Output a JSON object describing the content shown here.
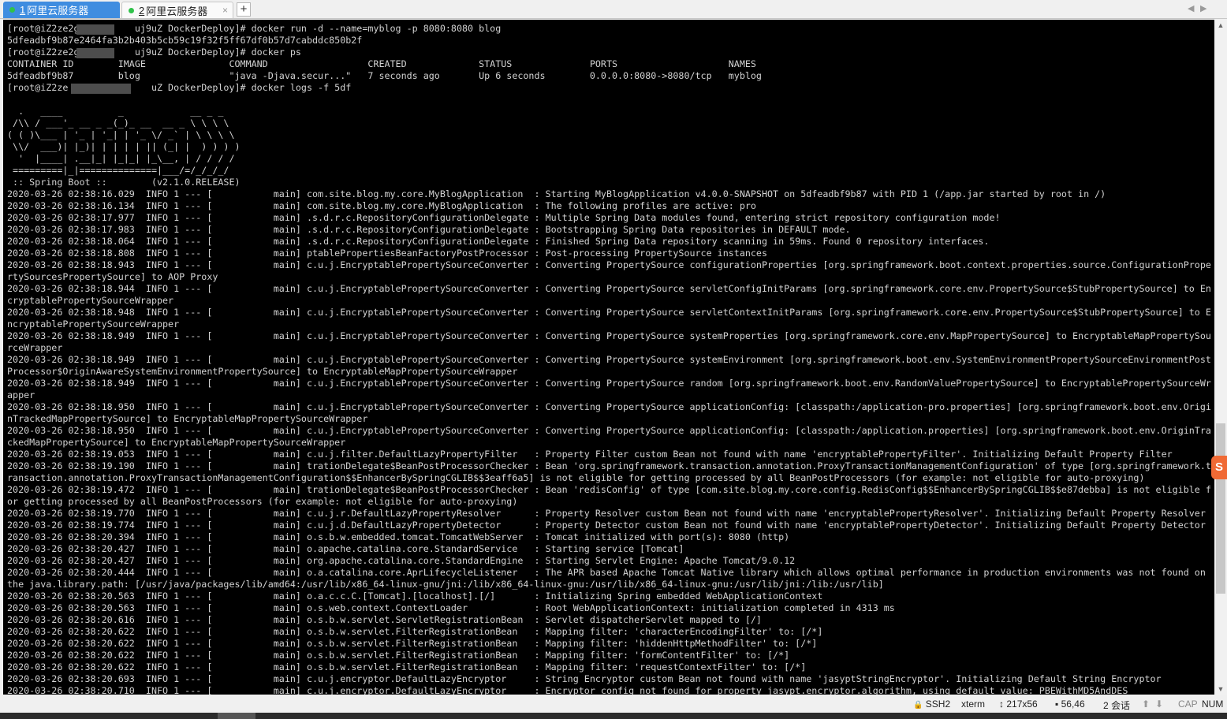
{
  "tabs": [
    {
      "num": "1",
      "label": "阿里云服务器",
      "active": true
    },
    {
      "num": "2",
      "label": "阿里云服务器",
      "active": false
    }
  ],
  "tab_controls": {
    "close": "×",
    "add": "+",
    "prev": "◀",
    "next": "▶"
  },
  "terminal": {
    "lines": [
      "[root@iZ2ze2g          uj9uZ DockerDeploy]# docker run -d --name=myblog -p 8080:8080 blog",
      "5dfeadbf9b87e2464fa3b2b403b5cb59c19f32f5ff67df0b57d7cabddc850b2f",
      "[root@iZ2ze2g          uj9uZ DockerDeploy]# docker ps",
      "CONTAINER ID        IMAGE               COMMAND                  CREATED             STATUS              PORTS                    NAMES",
      "5dfeadbf9b87        blog                \"java -Djava.secur...\"   7 seconds ago       Up 6 seconds        0.0.0.0:8080->8080/tcp   myblog",
      "[root@iZ2ze               uZ DockerDeploy]# docker logs -f 5df",
      "",
      "  .   ____          _            __ _ _",
      " /\\\\ / ___'_ __ _ _(_)_ __  __ _ \\ \\ \\ \\",
      "( ( )\\___ | '_ | '_| | '_ \\/ _` | \\ \\ \\ \\",
      " \\\\/  ___)| |_)| | | | | || (_| |  ) ) ) )",
      "  '  |____| .__|_| |_|_| |_\\__, | / / / /",
      " =========|_|==============|___/=/_/_/_/",
      " :: Spring Boot ::        (v2.1.0.RELEASE)",
      "2020-03-26 02:38:16.029  INFO 1 --- [           main] com.site.blog.my.core.MyBlogApplication  : Starting MyBlogApplication v4.0.0-SNAPSHOT on 5dfeadbf9b87 with PID 1 (/app.jar started by root in /)",
      "2020-03-26 02:38:16.134  INFO 1 --- [           main] com.site.blog.my.core.MyBlogApplication  : The following profiles are active: pro",
      "2020-03-26 02:38:17.977  INFO 1 --- [           main] .s.d.r.c.RepositoryConfigurationDelegate : Multiple Spring Data modules found, entering strict repository configuration mode!",
      "2020-03-26 02:38:17.983  INFO 1 --- [           main] .s.d.r.c.RepositoryConfigurationDelegate : Bootstrapping Spring Data repositories in DEFAULT mode.",
      "2020-03-26 02:38:18.064  INFO 1 --- [           main] .s.d.r.c.RepositoryConfigurationDelegate : Finished Spring Data repository scanning in 59ms. Found 0 repository interfaces.",
      "2020-03-26 02:38:18.808  INFO 1 --- [           main] ptablePropertiesBeanFactoryPostProcessor : Post-processing PropertySource instances",
      "2020-03-26 02:38:18.943  INFO 1 --- [           main] c.u.j.EncryptablePropertySourceConverter : Converting PropertySource configurationProperties [org.springframework.boot.context.properties.source.ConfigurationPrope",
      "rtySourcesPropertySource] to AOP Proxy",
      "2020-03-26 02:38:18.944  INFO 1 --- [           main] c.u.j.EncryptablePropertySourceConverter : Converting PropertySource servletConfigInitParams [org.springframework.core.env.PropertySource$StubPropertySource] to En",
      "cryptablePropertySourceWrapper",
      "2020-03-26 02:38:18.948  INFO 1 --- [           main] c.u.j.EncryptablePropertySourceConverter : Converting PropertySource servletContextInitParams [org.springframework.core.env.PropertySource$StubPropertySource] to E",
      "ncryptablePropertySourceWrapper",
      "2020-03-26 02:38:18.949  INFO 1 --- [           main] c.u.j.EncryptablePropertySourceConverter : Converting PropertySource systemProperties [org.springframework.core.env.MapPropertySource] to EncryptableMapPropertySou",
      "rceWrapper",
      "2020-03-26 02:38:18.949  INFO 1 --- [           main] c.u.j.EncryptablePropertySourceConverter : Converting PropertySource systemEnvironment [org.springframework.boot.env.SystemEnvironmentPropertySourceEnvironmentPost",
      "Processor$OriginAwareSystemEnvironmentPropertySource] to EncryptableMapPropertySourceWrapper",
      "2020-03-26 02:38:18.949  INFO 1 --- [           main] c.u.j.EncryptablePropertySourceConverter : Converting PropertySource random [org.springframework.boot.env.RandomValuePropertySource] to EncryptablePropertySourceWr",
      "apper",
      "2020-03-26 02:38:18.950  INFO 1 --- [           main] c.u.j.EncryptablePropertySourceConverter : Converting PropertySource applicationConfig: [classpath:/application-pro.properties] [org.springframework.boot.env.Origi",
      "nTrackedMapPropertySource] to EncryptableMapPropertySourceWrapper",
      "2020-03-26 02:38:18.950  INFO 1 --- [           main] c.u.j.EncryptablePropertySourceConverter : Converting PropertySource applicationConfig: [classpath:/application.properties] [org.springframework.boot.env.OriginTra",
      "ckedMapPropertySource] to EncryptableMapPropertySourceWrapper",
      "2020-03-26 02:38:19.053  INFO 1 --- [           main] c.u.j.filter.DefaultLazyPropertyFilter   : Property Filter custom Bean not found with name 'encryptablePropertyFilter'. Initializing Default Property Filter",
      "2020-03-26 02:38:19.190  INFO 1 --- [           main] trationDelegate$BeanPostProcessorChecker : Bean 'org.springframework.transaction.annotation.ProxyTransactionManagementConfiguration' of type [org.springframework.t",
      "ransaction.annotation.ProxyTransactionManagementConfiguration$$EnhancerBySpringCGLIB$$3eaff6a5] is not eligible for getting processed by all BeanPostProcessors (for example: not eligible for auto-proxying)",
      "2020-03-26 02:38:19.472  INFO 1 --- [           main] trationDelegate$BeanPostProcessorChecker : Bean 'redisConfig' of type [com.site.blog.my.core.config.RedisConfig$$EnhancerBySpringCGLIB$$e87debba] is not eligible f",
      "or getting processed by all BeanPostProcessors (for example: not eligible for auto-proxying)",
      "2020-03-26 02:38:19.770  INFO 1 --- [           main] c.u.j.r.DefaultLazyPropertyResolver      : Property Resolver custom Bean not found with name 'encryptablePropertyResolver'. Initializing Default Property Resolver",
      "2020-03-26 02:38:19.774  INFO 1 --- [           main] c.u.j.d.DefaultLazyPropertyDetector      : Property Detector custom Bean not found with name 'encryptablePropertyDetector'. Initializing Default Property Detector",
      "2020-03-26 02:38:20.394  INFO 1 --- [           main] o.s.b.w.embedded.tomcat.TomcatWebServer  : Tomcat initialized with port(s): 8080 (http)",
      "2020-03-26 02:38:20.427  INFO 1 --- [           main] o.apache.catalina.core.StandardService   : Starting service [Tomcat]",
      "2020-03-26 02:38:20.427  INFO 1 --- [           main] org.apache.catalina.core.StandardEngine  : Starting Servlet Engine: Apache Tomcat/9.0.12",
      "2020-03-26 02:38:20.444  INFO 1 --- [           main] o.a.catalina.core.AprLifecycleListener   : The APR based Apache Tomcat Native library which allows optimal performance in production environments was not found on",
      "the java.library.path: [/usr/java/packages/lib/amd64:/usr/lib/x86_64-linux-gnu/jni:/lib/x86_64-linux-gnu:/usr/lib/x86_64-linux-gnu:/usr/lib/jni:/lib:/usr/lib]",
      "2020-03-26 02:38:20.563  INFO 1 --- [           main] o.a.c.c.C.[Tomcat].[localhost].[/]       : Initializing Spring embedded WebApplicationContext",
      "2020-03-26 02:38:20.563  INFO 1 --- [           main] o.s.web.context.ContextLoader            : Root WebApplicationContext: initialization completed in 4313 ms",
      "2020-03-26 02:38:20.616  INFO 1 --- [           main] o.s.b.w.servlet.ServletRegistrationBean  : Servlet dispatcherServlet mapped to [/]",
      "2020-03-26 02:38:20.622  INFO 1 --- [           main] o.s.b.w.servlet.FilterRegistrationBean   : Mapping filter: 'characterEncodingFilter' to: [/*]",
      "2020-03-26 02:38:20.622  INFO 1 --- [           main] o.s.b.w.servlet.FilterRegistrationBean   : Mapping filter: 'hiddenHttpMethodFilter' to: [/*]",
      "2020-03-26 02:38:20.622  INFO 1 --- [           main] o.s.b.w.servlet.FilterRegistrationBean   : Mapping filter: 'formContentFilter' to: [/*]",
      "2020-03-26 02:38:20.622  INFO 1 --- [           main] o.s.b.w.servlet.FilterRegistrationBean   : Mapping filter: 'requestContextFilter' to: [/*]",
      "2020-03-26 02:38:20.693  INFO 1 --- [           main] c.u.j.encryptor.DefaultLazyEncryptor     : String Encryptor custom Bean not found with name 'jasyptStringEncryptor'. Initializing Default String Encryptor",
      "2020-03-26 02:38:20.710  INFO 1 --- [           main] c.u.j.encryptor.DefaultLazyEncryptor     : Encryptor config not found for property jasypt.encryptor.algorithm, using default value: PBEWithMD5AndDES"
    ]
  },
  "side_widget": {
    "label": "S"
  },
  "statusbar": {
    "protocol": "SSH2",
    "terminal_type": "xterm",
    "size": "217x56",
    "cursor": "56,46",
    "sessions": "2 会话",
    "caps": "CAP",
    "num": "NUM",
    "up_btn": "⬆",
    "down_btn": "⬇"
  },
  "colors": {
    "accent": "#3f8de0",
    "terminal_bg": "#000000",
    "terminal_fg": "#d2d2d2",
    "session_dot": "#2fc24a"
  }
}
